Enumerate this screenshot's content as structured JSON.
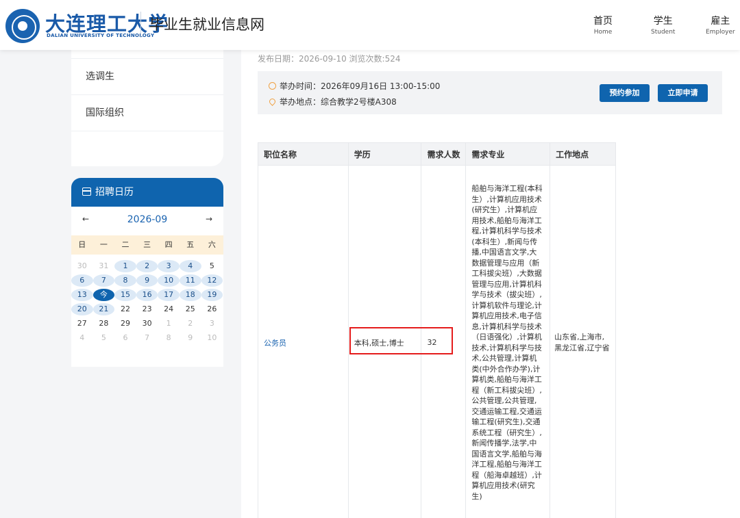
{
  "header": {
    "university_name": "大连理工大学",
    "university_en": "DALIAN UNIVERSITY OF TECHNOLOGY",
    "site_title": "毕业生就业信息网",
    "nav": [
      {
        "cn": "首页",
        "en": "Home"
      },
      {
        "cn": "学生",
        "en": "Student"
      },
      {
        "cn": "雇主",
        "en": "Employer"
      }
    ]
  },
  "sidebar": {
    "items": [
      {
        "label": "选调生"
      },
      {
        "label": "国际组织"
      }
    ]
  },
  "calendar": {
    "title": "招聘日历",
    "prev": "←",
    "month": "2026-09",
    "next": "→",
    "weekdays": [
      "日",
      "一",
      "二",
      "三",
      "四",
      "五",
      "六"
    ],
    "weeks": [
      [
        {
          "t": "30",
          "s": "muted"
        },
        {
          "t": "31",
          "s": "muted"
        },
        {
          "t": "1",
          "s": "event"
        },
        {
          "t": "2",
          "s": "event"
        },
        {
          "t": "3",
          "s": "event"
        },
        {
          "t": "4",
          "s": "event"
        },
        {
          "t": "5",
          "s": "plain"
        }
      ],
      [
        {
          "t": "6",
          "s": "event"
        },
        {
          "t": "7",
          "s": "event"
        },
        {
          "t": "8",
          "s": "event"
        },
        {
          "t": "9",
          "s": "event"
        },
        {
          "t": "10",
          "s": "event"
        },
        {
          "t": "11",
          "s": "event"
        },
        {
          "t": "12",
          "s": "event"
        }
      ],
      [
        {
          "t": "13",
          "s": "event"
        },
        {
          "t": "今",
          "s": "today"
        },
        {
          "t": "15",
          "s": "event"
        },
        {
          "t": "16",
          "s": "event"
        },
        {
          "t": "17",
          "s": "event"
        },
        {
          "t": "18",
          "s": "event"
        },
        {
          "t": "19",
          "s": "event"
        }
      ],
      [
        {
          "t": "20",
          "s": "event"
        },
        {
          "t": "21",
          "s": "event"
        },
        {
          "t": "22",
          "s": "plain"
        },
        {
          "t": "23",
          "s": "plain"
        },
        {
          "t": "24",
          "s": "plain"
        },
        {
          "t": "25",
          "s": "plain"
        },
        {
          "t": "26",
          "s": "plain"
        }
      ],
      [
        {
          "t": "27",
          "s": "plain"
        },
        {
          "t": "28",
          "s": "plain"
        },
        {
          "t": "29",
          "s": "plain"
        },
        {
          "t": "30",
          "s": "plain"
        },
        {
          "t": "1",
          "s": "muted"
        },
        {
          "t": "2",
          "s": "muted"
        },
        {
          "t": "3",
          "s": "muted"
        }
      ],
      [
        {
          "t": "4",
          "s": "muted"
        },
        {
          "t": "5",
          "s": "muted"
        },
        {
          "t": "6",
          "s": "muted"
        },
        {
          "t": "7",
          "s": "muted"
        },
        {
          "t": "8",
          "s": "muted"
        },
        {
          "t": "9",
          "s": "muted"
        },
        {
          "t": "10",
          "s": "muted"
        }
      ]
    ]
  },
  "event": {
    "publish": "发布日期：2026-09-10   浏览次数:524",
    "time": "举办时间：2026年09月16日 13:00-15:00",
    "place": "举办地点：综合教学2号楼A308",
    "btn_reserve": "预约参加",
    "btn_apply": "立即申请"
  },
  "table": {
    "headers": [
      "职位名称",
      "学历",
      "需求人数",
      "需求专业",
      "工作地点"
    ],
    "rows": [
      {
        "title": "公务员",
        "education": "本科,硕士,博士",
        "count": "32",
        "major": "船舶与海洋工程(本科生）,计算机应用技术(研究生）,计算机应用技术,船舶与海洋工程,计算机科学与技术(本科生）,新闻与传播,中国语言文学,大数据管理与应用（新工科拔尖班）,大数据管理与应用,计算机科学与技术（拔尖班）,计算机软件与理论,计算机应用技术,电子信息,计算机科学与技术（日语强化）,计算机技术,计算机科学与技术,公共管理,计算机类(中外合作办学),计算机类,船舶与海洋工程（新工科拔尖班）,公共管理,公共管理,交通运输工程,交通运输工程(研究生),交通系统工程（研究生）,新闻传播学,法学,中国语言文学,船舶与海洋工程,船舶与海洋工程（船海卓越班）,计算机应用技术(研究生)",
        "location": "山东省,上海市,黑龙江省,辽宁省"
      }
    ]
  },
  "colors": {
    "primary": "#0f64ae",
    "calendar_week_bg": "#fdf0d9",
    "event_day_bg": "#dce9f6",
    "highlight": "#e51b1b",
    "icon_orange": "#f0a040"
  }
}
